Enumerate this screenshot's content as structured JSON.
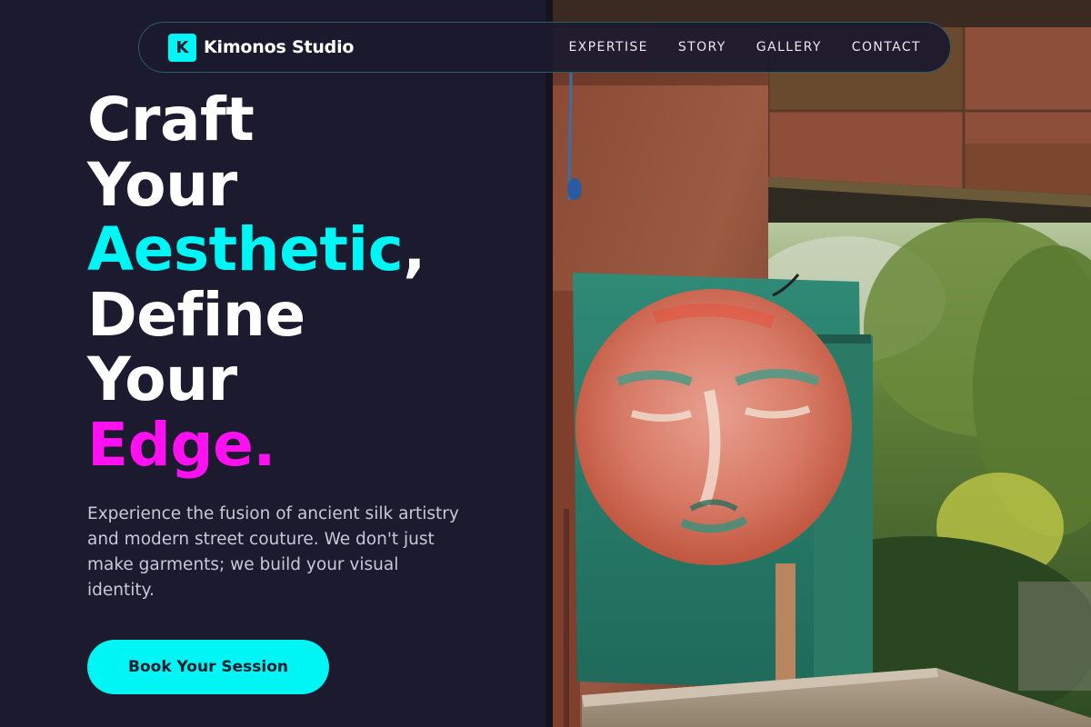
{
  "brand": {
    "mark": "K",
    "name": "Kimonos Studio"
  },
  "nav": {
    "links": [
      {
        "label": "EXPERTISE"
      },
      {
        "label": "STORY"
      },
      {
        "label": "GALLERY"
      },
      {
        "label": "CONTACT"
      }
    ]
  },
  "hero": {
    "headline": {
      "line1": "Craft",
      "line2": "Your",
      "line3_accent": "Aesthetic",
      "line3_suffix": ",",
      "line4": "Define",
      "line5": "Your",
      "line6_accent": "Edge."
    },
    "description": "Experience the fusion of ancient silk artistry and modern street couture. We don't just make garments; we build your visual identity.",
    "cta_label": "Book Your Session"
  },
  "image": {
    "subject": "painted-moon-face-panel-photo"
  },
  "colors": {
    "background": "#1c1a2e",
    "accent_cyan": "#00f5f5",
    "accent_magenta": "#ff10f0",
    "text_primary": "#ffffff",
    "text_muted": "#c9c8d4"
  }
}
